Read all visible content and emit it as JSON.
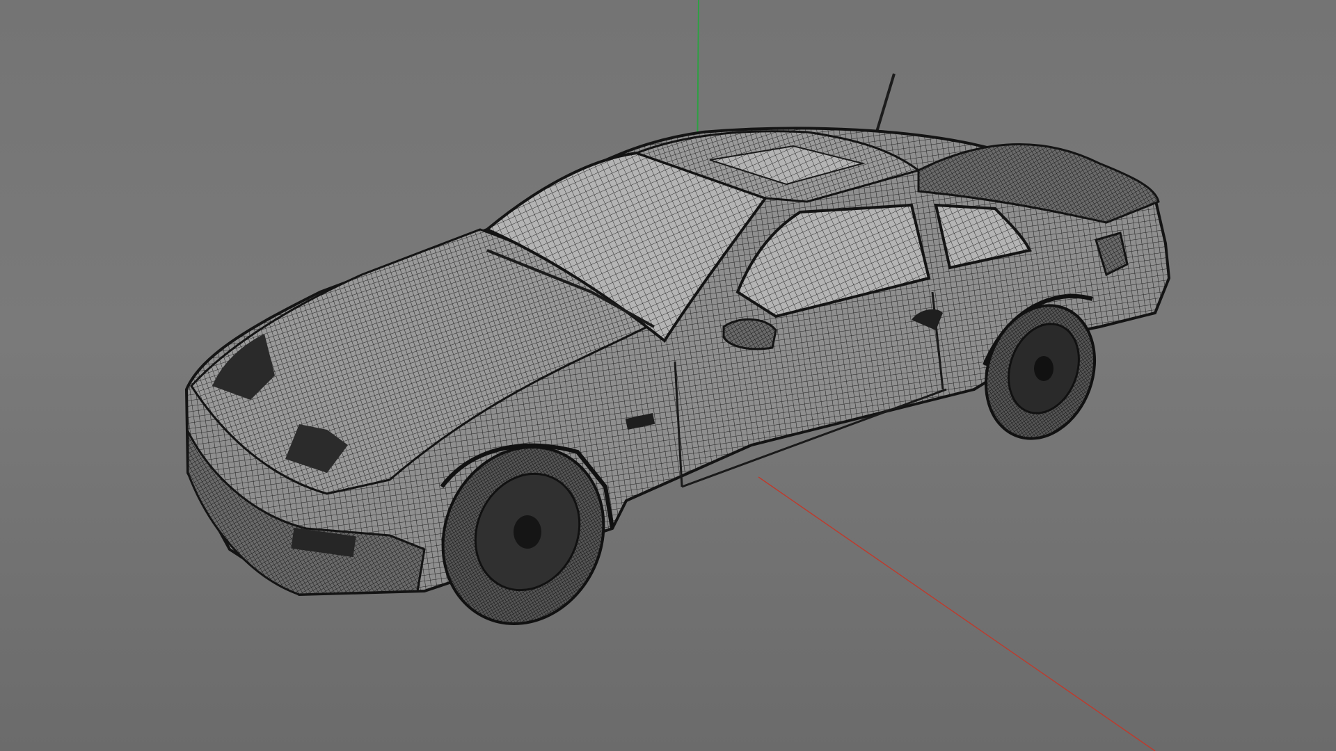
{
  "viewport": {
    "background_top": "#747474",
    "background_bottom": "#6b6b6b",
    "render_mode": "wireframe"
  },
  "model": {
    "subject": "sports car",
    "wire_color": "#1c1c1c",
    "surface_color": "#8e8e8e",
    "highlight_color": "#b8b8b8"
  },
  "axes": {
    "y_axis_color": "#2ea043",
    "x_axis_color": "#c0392b"
  }
}
